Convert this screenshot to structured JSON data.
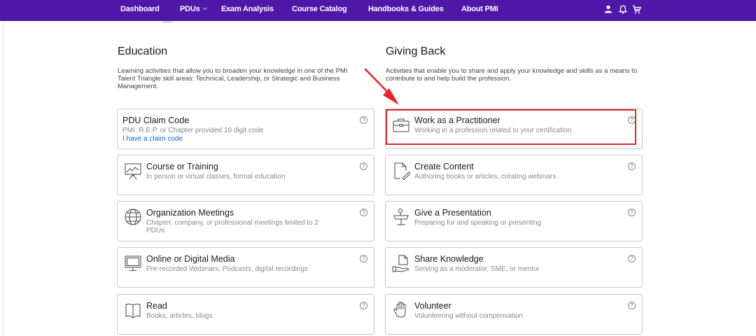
{
  "nav": {
    "items": [
      {
        "label": "Dashboard"
      },
      {
        "label": "PDUs",
        "has_dropdown": true
      },
      {
        "label": "Exam Analysis"
      },
      {
        "label": "Course Catalog"
      },
      {
        "label": "Handbooks & Guides"
      },
      {
        "label": "About PMI"
      }
    ],
    "icons": [
      "user-icon",
      "bell-icon",
      "cart-icon"
    ],
    "background": "#4f17a8"
  },
  "education": {
    "title": "Education",
    "description": "Learning activities that allow you to broaden your knowledge in one of the PMI Talent Triangle skill areas: Technical, Leadership, or Strategic and Business Management.",
    "cards": [
      {
        "title": "PDU Claim Code",
        "subtitle": "PMI, R.E.P. or Chapter provided 10 digit code",
        "link": "I have a claim code",
        "icon": "none"
      },
      {
        "title": "Course or Training",
        "subtitle": "In person or virtual classes, formal education",
        "icon": "presentation-board-icon"
      },
      {
        "title": "Organization Meetings",
        "subtitle": "Chapter, company, or professional meetings limited to 2 PDUs",
        "icon": "globe-icon"
      },
      {
        "title": "Online or Digital Media",
        "subtitle": "Pre-recorded Webinars, Podcasts, digital recordings",
        "icon": "monitor-icon"
      },
      {
        "title": "Read",
        "subtitle": "Books, articles, blogs",
        "icon": "book-icon"
      }
    ]
  },
  "giving_back": {
    "title": "Giving Back",
    "description": "Activities that enable you to share and apply your knowledge and skills as a means to contribute to and help build the profession.",
    "cards": [
      {
        "title": "Work as a Practitioner",
        "subtitle": "Working in a profession related to your certification",
        "icon": "briefcase-icon",
        "highlighted": true
      },
      {
        "title": "Create Content",
        "subtitle": "Authoring books or articles, creating webinars",
        "icon": "document-pen-icon"
      },
      {
        "title": "Give a Presentation",
        "subtitle": "Preparing for and speaking or presenting",
        "icon": "podium-icon"
      },
      {
        "title": "Share Knowledge",
        "subtitle": "Serving as a moderator, SME, or mentor",
        "icon": "share-hand-icon"
      },
      {
        "title": "Volunteer",
        "subtitle": "Volunteering without compensation",
        "icon": "raised-hand-icon"
      }
    ]
  },
  "help_glyph": "?",
  "annotation": {
    "color": "#e8232a"
  }
}
